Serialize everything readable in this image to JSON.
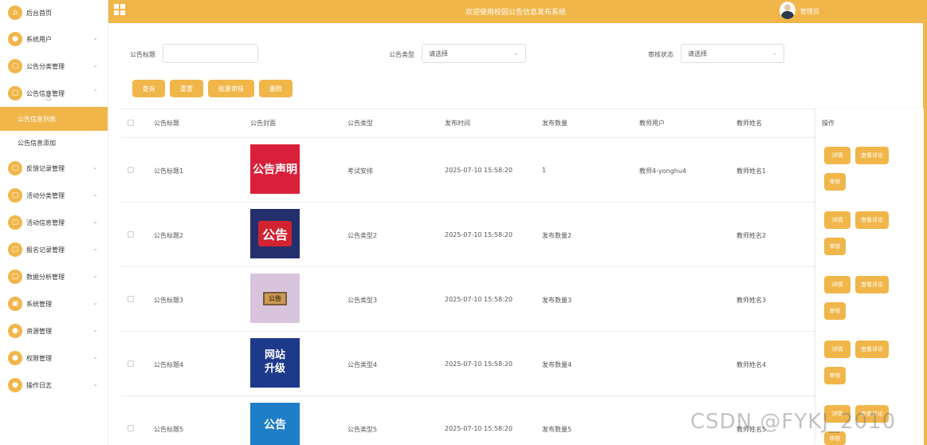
{
  "app": {
    "title": "欢迎使用校园公告信息发布系统",
    "user": "管理员"
  },
  "sidebar": {
    "items": [
      {
        "label": "后台首页",
        "icon": "home-icon",
        "chevron": false
      },
      {
        "label": "系统用户",
        "icon": "user-icon",
        "chevron": true
      },
      {
        "label": "公告分类管理",
        "icon": "folder-icon",
        "chevron": true
      },
      {
        "label": "公告信息管理",
        "icon": "folder-icon",
        "chevron": true,
        "expanded": true
      },
      {
        "label": "反馈记录管理",
        "icon": "folder-icon",
        "chevron": true
      },
      {
        "label": "活动分类管理",
        "icon": "folder-icon",
        "chevron": true
      },
      {
        "label": "活动信息管理",
        "icon": "folder-icon",
        "chevron": true
      },
      {
        "label": "报名记录管理",
        "icon": "folder-icon",
        "chevron": true
      },
      {
        "label": "数据分析管理",
        "icon": "folder-icon",
        "chevron": true
      },
      {
        "label": "系统管理",
        "icon": "image-icon",
        "chevron": true
      },
      {
        "label": "资源管理",
        "icon": "location-icon",
        "chevron": true
      },
      {
        "label": "权限管理",
        "icon": "user-icon",
        "chevron": true
      },
      {
        "label": "操作日志",
        "icon": "user-icon",
        "chevron": true
      }
    ],
    "subitems": [
      {
        "label": "公告信息列表",
        "active": true
      },
      {
        "label": "公告信息添加",
        "active": false
      }
    ]
  },
  "filters": {
    "title_label": "公告标题",
    "title_value": "",
    "type_label": "公告类型",
    "type_value": "请选择",
    "status_label": "审核状态",
    "status_value": "请选择"
  },
  "actions": {
    "search": "查询",
    "reset": "重置",
    "batch_review": "批量审核",
    "delete": "删除"
  },
  "table": {
    "headers": {
      "title": "公告标题",
      "cover": "公告封面",
      "type": "公告类型",
      "time": "发布时间",
      "count": "发布数量",
      "teacher": "教师用户",
      "teacher_name": "教师姓名",
      "ops": "操作"
    },
    "rows": [
      {
        "title": "公告标题1",
        "cover": "公告声明",
        "type": "考试安排",
        "time": "2025-07-10 15:58:20",
        "count": "1",
        "teacher": "教师4-yonghu4",
        "teacher_name": "教师姓名1"
      },
      {
        "title": "公告标题2",
        "cover": "公告",
        "type": "公告类型2",
        "time": "2025-07-10 15:58:20",
        "count": "发布数量2",
        "teacher": "",
        "teacher_name": "教师姓名2"
      },
      {
        "title": "公告标题3",
        "cover": "公告",
        "type": "公告类型3",
        "time": "2025-07-10 15:58:20",
        "count": "发布数量3",
        "teacher": "",
        "teacher_name": "教师姓名3"
      },
      {
        "title": "公告标题4",
        "cover": "网站升级",
        "type": "公告类型4",
        "time": "2025-07-10 15:58:20",
        "count": "发布数量4",
        "teacher": "",
        "teacher_name": "教师姓名4"
      },
      {
        "title": "公告标题5",
        "cover": "公告",
        "type": "公告类型5",
        "time": "2025-07-10 15:58:20",
        "count": "发布数量5",
        "teacher": "",
        "teacher_name": "教师姓名5"
      }
    ],
    "ops": {
      "detail": "详情",
      "comments": "查看评论",
      "review": "审核"
    }
  },
  "watermark": "CSDN @FYKJ_2010",
  "colors": {
    "accent": "#f1b64a",
    "text": "#444444"
  }
}
